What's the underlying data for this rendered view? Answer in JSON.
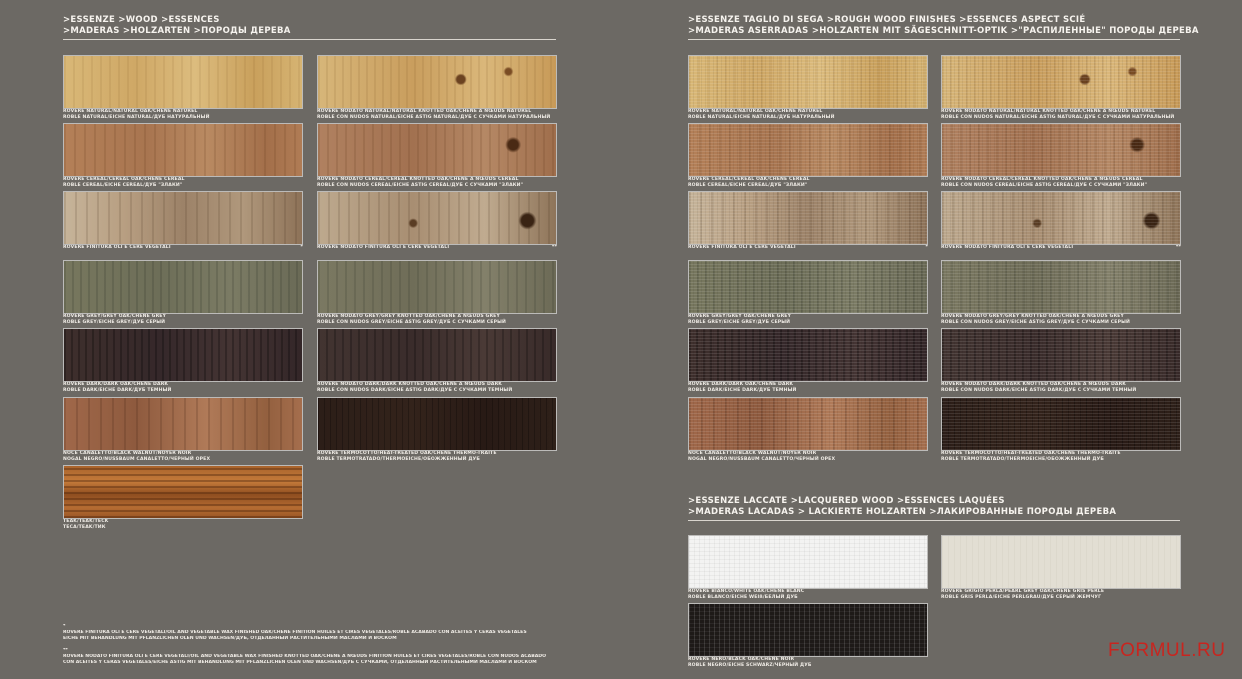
{
  "left_header": {
    "line1": ">ESSENZE >WOOD >ESSENCES",
    "line2": ">MADERAS >HOLZARTEN >ПОРОДЫ ДЕРЕВА"
  },
  "right_header": {
    "line1": ">ESSENZE TAGLIO DI SEGA >ROUGH WOOD FINISHES >ESSENCES ASPECT SCIÉ",
    "line2": ">MADERAS ASERRADAS >HOLZARTEN MIT SÄGESCHNITT-OPTIK >\"РАСПИЛЕННЫЕ\" ПОРОДЫ ДЕРЕВА"
  },
  "lacquered_header": {
    "line1": ">ESSENZE LACCATE >LACQUERED WOOD >ESSENCES LAQUÉES",
    "line2": ">MADERAS LACADAS > LACKIERTE HOLZARTEN >ЛАКИРОВАННЫЕ ПОРОДЫ ДЕРЕВА"
  },
  "wood": [
    {
      "l1": "ROVERE NATURAL/NATURAL OAK/CHÊNE NATUREL",
      "l2": "ROBLE NATURAL/EICHE NATURAL/ДУБ НАТУРАЛЬНЫЙ",
      "mark": ""
    },
    {
      "l1": "ROVERE NODATO NATURAL/NATURAL KNOTTED OAK/CHÊNE À NŒUDS NATUREL",
      "l2": "ROBLE CON NUDOS NATURAL/EICHE ASTIG NATURAL/ДУБ С СУЧКАМИ НАТУРАЛЬНЫЙ",
      "mark": ""
    },
    {
      "l1": "ROVERE CEREAL/CEREAL OAK/CHÊNE CEREAL",
      "l2": "ROBLE CEREAL/EICHE CEREAL/ДУБ \"ЗЛАКИ\"",
      "mark": ""
    },
    {
      "l1": "ROVERE NODATO CEREAL/CEREAL KNOTTED OAK/CHÊNE À NŒUDS CEREAL",
      "l2": "ROBLE CON NUDOS CEREAL/EICHE ASTIG CEREAL/ДУБ С СУЧКАМИ \"ЗЛАКИ\"",
      "mark": ""
    },
    {
      "l1": "ROVERE FINITURA OLI E CERE VEGETALI",
      "l2": "",
      "mark": "*"
    },
    {
      "l1": "ROVERE NODATO FINITURA OLI E CERE VEGETALI",
      "l2": "",
      "mark": "**"
    },
    {
      "l1": "ROVERE GREY/GREY OAK/CHÊNE GREY",
      "l2": "ROBLE GREY/EICHE GREY/ДУБ СЕРЫЙ",
      "mark": ""
    },
    {
      "l1": "ROVERE NODATO GREY/GREY KNOTTED OAK/CHÊNE À NŒUDS GREY",
      "l2": "ROBLE CON NUDOS GREY/EICHE ASTIG GREY/ДУБ С СУЧКАМИ СЕРЫЙ",
      "mark": ""
    },
    {
      "l1": "ROVERE DARK/DARK OAK/CHÊNE DARK",
      "l2": "ROBLE DARK/EICHE DARK/ДУБ ТЕМНЫЙ",
      "mark": ""
    },
    {
      "l1": "ROVERE NODATO DARK/DARK KNOTTED OAK/CHÊNE À NŒUDS DARK",
      "l2": "ROBLE CON NUDOS DARK/EICHE ASTIG DARK/ДУБ С СУЧКАМИ ТЕМНЫЙ",
      "mark": ""
    },
    {
      "l1": "NOCE CANALETTO/BLACK WALNUT/NOYER NOIR",
      "l2": "NOGAL NEGRO/NUSSBAUM CANALETTO/ЧЕРНЫЙ ОРЕХ",
      "mark": ""
    },
    {
      "l1": "ROVERE TERMOCOTTO/HEAT-TREATED OAK/CHÊNE THERMO-TRAITÉ",
      "l2": "ROBLE TERMOTRATADO/THERMOEICHE/ОБОЖЖЕННЫЙ ДУБ",
      "mark": ""
    }
  ],
  "teak": {
    "l1": "TEAK/TEAK/TECK",
    "l2": "TECA/TEAK/ТИК"
  },
  "lacquered": [
    {
      "l1": "ROVERE BIANCO/WHITE OAK/CHÊNE BLANC",
      "l2": "ROBLE BLANCO/EICHE WEIß/БЕЛЫЙ ДУБ"
    },
    {
      "l1": "ROVERE GRIGIO PERLA/PEARL GREY OAK/CHÊNE GRIS PERLE",
      "l2": "ROBLE GRIS PERLA/EICHE PERLGRAU/ДУБ СЕРЫЙ ЖЕМЧУГ"
    },
    {
      "l1": "ROVERE NERO/BLACK OAK/CHÊNE NOIR",
      "l2": "ROBLE NEGRO/EICHE SCHWARZ/ЧЕРНЫЙ ДУБ"
    }
  ],
  "footnotes": {
    "star1": "*",
    "note1_l1": "ROVERE FINITURA OLI E CERE VEGETALI/OIL AND VEGETABLE WAX FINISHED OAK/CHÊNE FINITION HUILES ET CIRES VÉGÉTALES/ROBLE ACABADO CON ACEITES Y CERAS VEGETALES",
    "note1_l2": "EICHE MIT BEHANDLUNG MIT PFLANZLICHEN ÖLEN UND WACHSEN/ДУБ, ОТДЕЛАННЫЙ РАСТИТЕЛЬНЫМИ МАСЛАМИ И ВОСКОМ",
    "star2": "**",
    "note2_l1": "ROVERE NODATO FINITURA OLI E CERE VEGETALI/OIL AND VEGETABLE WAX FINISHED KNOTTED OAK/CHÊNE À NŒUDS FINITION HUILES ET CIRES VÉGÉTALES/ROBLE CON NUDOS ACABADO",
    "note2_l2": "CON ACEITES Y CERAS VEGETALES/EICHE ASTIG MIT BEHANDLUNG MIT PFLANZLICHEN ÖLEN UND WACHSEN/ДУБ С СУЧКАМИ, ОТДЕЛАННЫЙ РАСТИТЕЛЬНЫМИ МАСЛАМИ И ВОСКОМ"
  },
  "brand": "FORMUL.RU"
}
